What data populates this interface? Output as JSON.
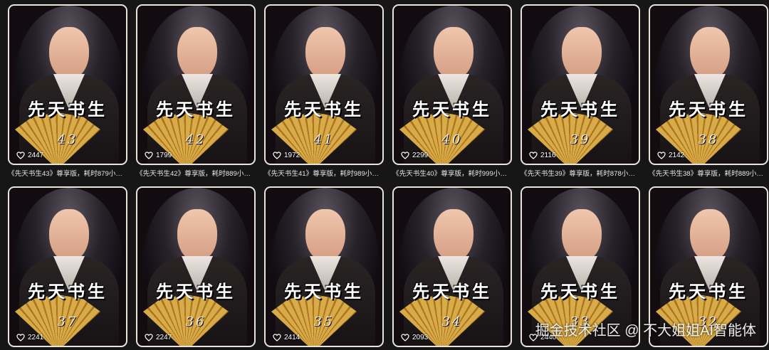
{
  "videos": [
    {
      "title_art": "先天书生",
      "episode": "43",
      "likes": "2447",
      "caption": "《先天书生43》尊享版，耗时879小…"
    },
    {
      "title_art": "先天书生",
      "episode": "42",
      "likes": "1799",
      "caption": "《先天书生42》尊享版，耗时889小…"
    },
    {
      "title_art": "先天书生",
      "episode": "41",
      "likes": "1972",
      "caption": "《先天书生41》尊享版，耗时989小…"
    },
    {
      "title_art": "先天书生",
      "episode": "40",
      "likes": "2299",
      "caption": "《先天书生40》尊享版，耗时999小…"
    },
    {
      "title_art": "先天书生",
      "episode": "39",
      "likes": "2116",
      "caption": "《先天书生39》尊享版，耗时878小…"
    },
    {
      "title_art": "先天书生",
      "episode": "38",
      "likes": "2142",
      "caption": "《先天书生38》尊享版，耗时889小…"
    },
    {
      "title_art": "先天书生",
      "episode": "37",
      "likes": "2241",
      "caption": ""
    },
    {
      "title_art": "先天书生",
      "episode": "36",
      "likes": "2247",
      "caption": ""
    },
    {
      "title_art": "先天书生",
      "episode": "35",
      "likes": "2414",
      "caption": ""
    },
    {
      "title_art": "先天书生",
      "episode": "34",
      "likes": "2093",
      "caption": ""
    },
    {
      "title_art": "先天书生",
      "episode": "33",
      "likes": "2440",
      "caption": ""
    },
    {
      "title_art": "先天书生",
      "episode": "32",
      "likes": "",
      "caption": ""
    }
  ],
  "icons": {
    "likes": "heart-outline-icon"
  },
  "watermark": "掘金技术社区 @ 不大姐姐AI智能体"
}
